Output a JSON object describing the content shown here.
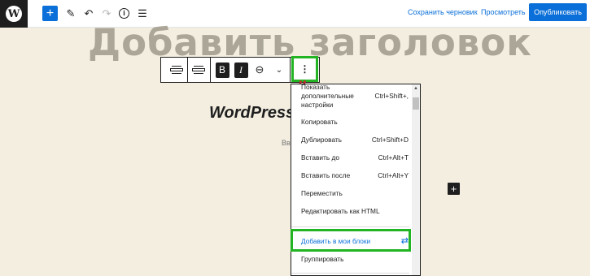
{
  "topbar": {
    "logo": "W",
    "add_symbol": "+",
    "edit_symbol": "✎",
    "undo_symbol": "↶",
    "redo_symbol": "↷",
    "info_symbol": "i",
    "list_symbol": "☰",
    "save_draft": "Сохранить черновик",
    "preview": "Просмотреть",
    "publish": "Опубликовать"
  },
  "canvas": {
    "title_placeholder": "Добавить заголовок",
    "quote_mark": "”",
    "quote_heading": "WordPress",
    "quote_sub": "Вв",
    "add_symbol": "+"
  },
  "block_toolbar": {
    "bold": "B",
    "italic": "I",
    "link_symbol": "⊖",
    "chevron": "⌄",
    "more_symbol": "⋮"
  },
  "menu": {
    "items": [
      {
        "label": "Показать дополнительные настройки",
        "shortcut": "Ctrl+Shift+,"
      },
      {
        "label": "Копировать",
        "shortcut": ""
      },
      {
        "label": "Дублировать",
        "shortcut": "Ctrl+Shift+D"
      },
      {
        "label": "Вставить до",
        "shortcut": "Ctrl+Alt+T"
      },
      {
        "label": "Вставить после",
        "shortcut": "Ctrl+Alt+Y"
      },
      {
        "label": "Переместить",
        "shortcut": ""
      },
      {
        "label": "Редактировать как HTML",
        "shortcut": ""
      },
      {
        "label": "Добавить в мои блоки",
        "shortcut": ""
      },
      {
        "label": "Группировать",
        "shortcut": ""
      }
    ],
    "reuse_symbol": "⇄"
  },
  "colors": {
    "accent": "#0a6fd8",
    "highlight": "#22b422",
    "canvas_bg": "#f3eee0",
    "title_gray": "#aba698",
    "quote_red": "#c5282f"
  }
}
